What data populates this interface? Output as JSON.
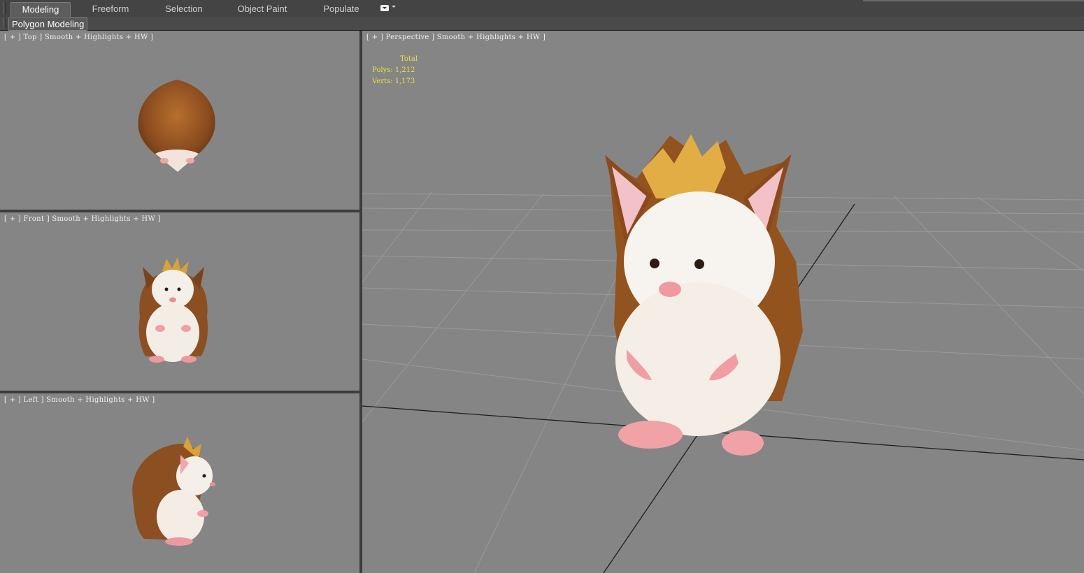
{
  "ribbon": {
    "tabs": [
      {
        "label": "Modeling",
        "active": true
      },
      {
        "label": "Freeform",
        "active": false
      },
      {
        "label": "Selection",
        "active": false
      },
      {
        "label": "Object Paint",
        "active": false
      },
      {
        "label": "Populate",
        "active": false
      }
    ],
    "dropdown_icon": "ribbon-options-icon"
  },
  "subpanel": {
    "label": "Polygon Modeling"
  },
  "viewports": {
    "top": {
      "label": "[ + ] Top ] Smooth + Highlights + HW ]"
    },
    "front": {
      "label": "[ + ] Front ] Smooth + Highlights + HW ]"
    },
    "left": {
      "label": "[ + ] Left ] Smooth + Highlights + HW ]"
    },
    "perspective": {
      "label": "[ + ] Perspective ] Smooth + Highlights + HW ]",
      "stats": {
        "header": "Total",
        "polys_label": "Polys:",
        "polys": "1,212",
        "verts_label": "Verts:",
        "verts": "1,173"
      }
    }
  },
  "colors": {
    "viewport_bg": "#858585",
    "stats_text": "#e7e33f",
    "active_tab_bg": "#5d5d5d"
  }
}
